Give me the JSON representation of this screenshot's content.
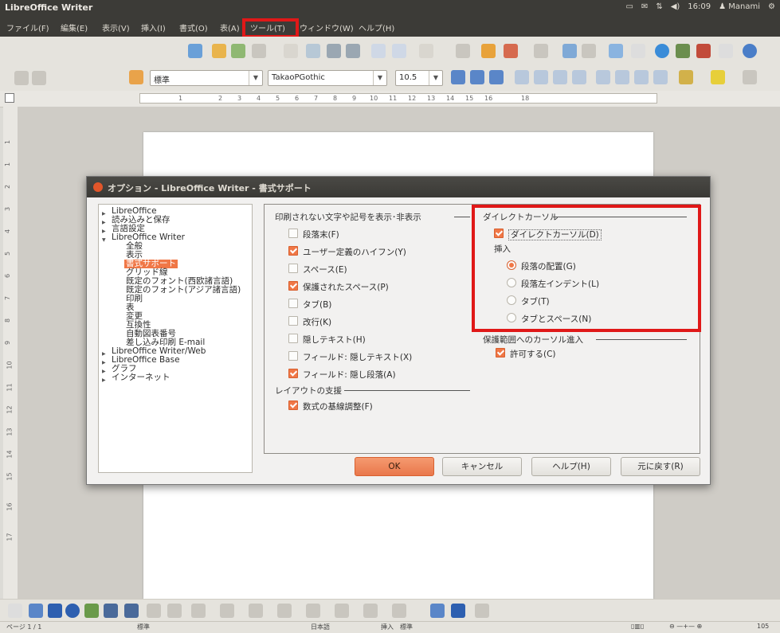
{
  "topbar": {
    "title": "LibreOffice Writer",
    "clock": "16:09",
    "user": "Manami"
  },
  "menubar": {
    "items": [
      {
        "label": "ファイル(F)"
      },
      {
        "label": "編集(E)"
      },
      {
        "label": "表示(V)"
      },
      {
        "label": "挿入(I)"
      },
      {
        "label": "書式(O)"
      },
      {
        "label": "表(A)"
      },
      {
        "label": "ツール(T)"
      },
      {
        "label": "ウィンドウ(W)"
      },
      {
        "label": "ヘルプ(H)"
      }
    ]
  },
  "formatting": {
    "style": "標準",
    "font": "TakaoPGothic",
    "size": "10.5"
  },
  "ruler_numbers": [
    "1",
    "2",
    "3",
    "4",
    "5",
    "6",
    "7",
    "8",
    "9",
    "10",
    "11",
    "12",
    "13",
    "14",
    "15",
    "16",
    "18"
  ],
  "vruler_numbers": [
    "1",
    "1",
    "2",
    "3",
    "4",
    "5",
    "6",
    "7",
    "8",
    "9",
    "10",
    "11",
    "12",
    "13",
    "14",
    "15",
    "16",
    "17"
  ],
  "status": {
    "page": "ページ 1 / 1",
    "style": "標準",
    "language": "日本語",
    "insert_mode": "挿入",
    "selection_mode": "標準",
    "zoom": "105"
  },
  "dialog": {
    "title": "オプション - LibreOffice Writer - 書式サポート",
    "tree": [
      {
        "label": "LibreOffice",
        "expander": "right"
      },
      {
        "label": "読み込みと保存",
        "expander": "right"
      },
      {
        "label": "言語設定",
        "expander": "right"
      },
      {
        "label": "LibreOffice Writer",
        "expander": "down"
      },
      {
        "label": "全般",
        "expander": "none"
      },
      {
        "label": "表示",
        "expander": "none"
      },
      {
        "label": "書式サポート",
        "expander": "none",
        "selected": true
      },
      {
        "label": "グリッド線",
        "expander": "none"
      },
      {
        "label": "既定のフォント(西欧諸言語)",
        "expander": "none"
      },
      {
        "label": "既定のフォント(アジア諸言語)",
        "expander": "none"
      },
      {
        "label": "印刷",
        "expander": "none"
      },
      {
        "label": "表",
        "expander": "none"
      },
      {
        "label": "変更",
        "expander": "none"
      },
      {
        "label": "互換性",
        "expander": "none"
      },
      {
        "label": "自動図表番号",
        "expander": "none"
      },
      {
        "label": "差し込み印刷 E-mail",
        "expander": "none"
      },
      {
        "label": "LibreOffice Writer/Web",
        "expander": "right"
      },
      {
        "label": "LibreOffice Base",
        "expander": "right"
      },
      {
        "label": "グラフ",
        "expander": "right"
      },
      {
        "label": "インターネット",
        "expander": "right"
      }
    ],
    "nonprint_group": "印刷されない文字や記号を表示･非表示",
    "nonprint": [
      {
        "label": "段落末(F)",
        "checked": false
      },
      {
        "label": "ユーザー定義のハイフン(Y)",
        "checked": true
      },
      {
        "label": "スペース(E)",
        "checked": false
      },
      {
        "label": "保護されたスペース(P)",
        "checked": true
      },
      {
        "label": "タブ(B)",
        "checked": false
      },
      {
        "label": "改行(K)",
        "checked": false
      },
      {
        "label": "隠しテキスト(H)",
        "checked": false
      },
      {
        "label": "フィールド: 隠しテキスト(X)",
        "checked": false
      },
      {
        "label": "フィールド: 隠し段落(A)",
        "checked": true
      }
    ],
    "layout_group": "レイアウトの支援",
    "layout": [
      {
        "label": "数式の基線調整(F)",
        "checked": true
      }
    ],
    "cursor_group": "ダイレクトカーソル",
    "cursor_checkbox": {
      "label": "ダイレクトカーソル(D)",
      "checked": true
    },
    "insert_label": "挿入",
    "insert_options": [
      {
        "label": "段落の配置(G)",
        "selected": true
      },
      {
        "label": "段落左インデント(L)",
        "selected": false
      },
      {
        "label": "タブ(T)",
        "selected": false
      },
      {
        "label": "タブとスペース(N)",
        "selected": false
      }
    ],
    "protect_group": "保護範囲へのカーソル進入",
    "protect_checkbox": {
      "label": "許可する(C)",
      "checked": true
    },
    "buttons": {
      "ok": "OK",
      "cancel": "キャンセル",
      "help": "ヘルプ(H)",
      "reset": "元に戻す(R)"
    }
  },
  "colors": {
    "accent": "#f07746",
    "highlight_box": "#e01818",
    "titlebar": "#3c3b37"
  }
}
